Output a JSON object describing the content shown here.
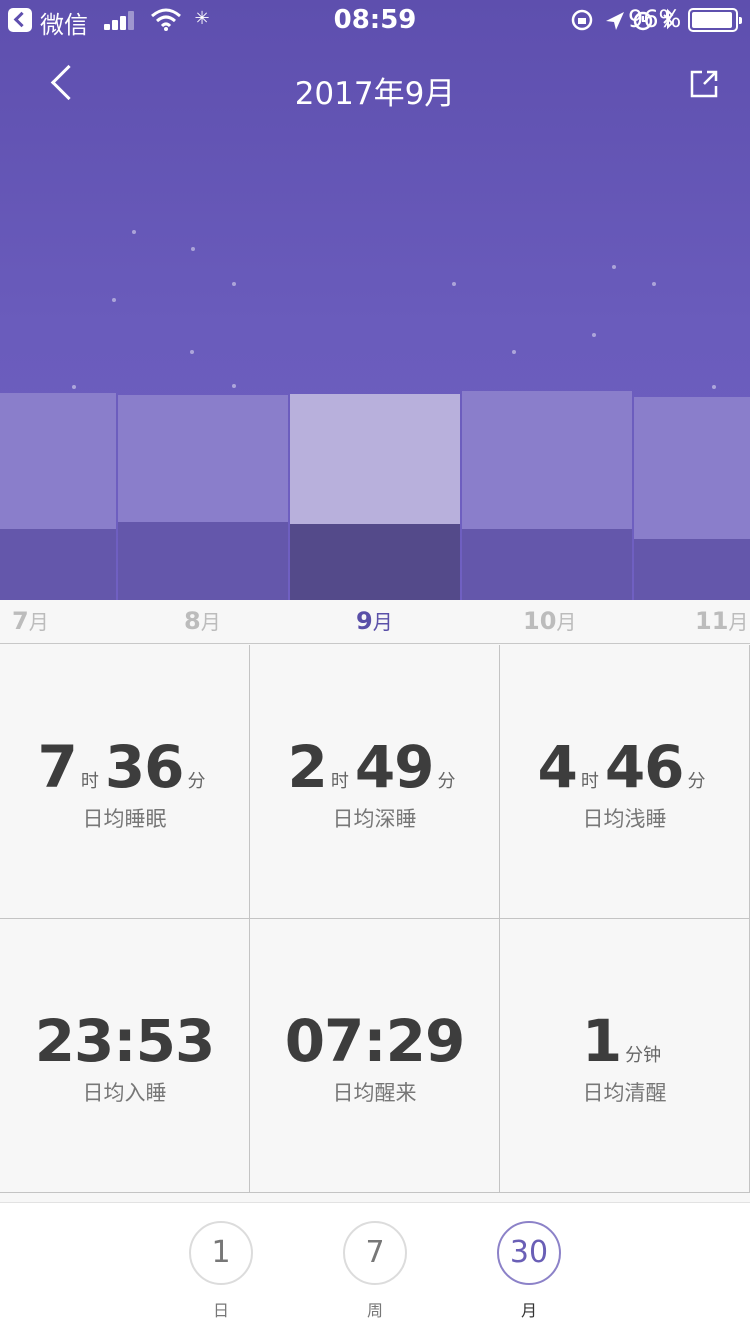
{
  "status_bar": {
    "app_name": "微信",
    "time": "08:59",
    "battery": "96%"
  },
  "header": {
    "title": "2017年9月"
  },
  "months": [
    {
      "num": "7",
      "suffix": "月"
    },
    {
      "num": "8",
      "suffix": "月"
    },
    {
      "num": "9",
      "suffix": "月"
    },
    {
      "num": "10",
      "suffix": "月"
    },
    {
      "num": "11",
      "suffix": "月"
    }
  ],
  "stats": {
    "sleep": {
      "hours": "7",
      "hour_unit": "时",
      "minutes": "36",
      "minute_unit": "分",
      "label": "日均睡眠"
    },
    "deep": {
      "hours": "2",
      "hour_unit": "时",
      "minutes": "49",
      "minute_unit": "分",
      "label": "日均深睡"
    },
    "light": {
      "hours": "4",
      "hour_unit": "时",
      "minutes": "46",
      "minute_unit": "分",
      "label": "日均浅睡"
    },
    "bedtime": {
      "value": "23:53",
      "label": "日均入睡"
    },
    "wake": {
      "value": "07:29",
      "label": "日均醒来"
    },
    "awake": {
      "value": "1",
      "unit": "分钟",
      "label": "日均清醒"
    }
  },
  "tabs": [
    {
      "number": "1",
      "label": "日"
    },
    {
      "number": "7",
      "label": "周"
    },
    {
      "number": "30",
      "label": "月"
    }
  ],
  "colors": {
    "accent": "#5a50a8",
    "bar_light": "#8a7ecb",
    "bar_dark": "#6457ab",
    "bar_selected_light": "#b8b0dc",
    "bar_selected_dark": "#544a8a"
  }
}
